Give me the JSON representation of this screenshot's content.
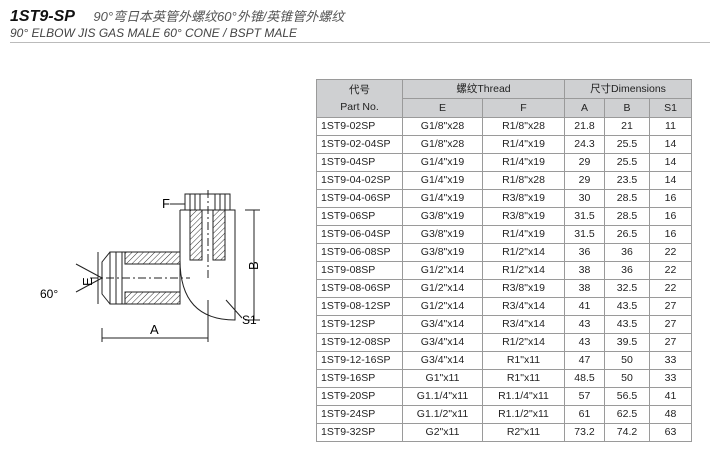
{
  "header": {
    "code": "1ST9-SP",
    "title_cn": "90°弯日本英管外螺纹60°外锥/英锥管外螺纹",
    "title_en": "90° ELBOW JIS GAS MALE 60° CONE / BSPT MALE"
  },
  "drawing": {
    "labels": {
      "f": "F",
      "b": "B",
      "e": "E",
      "a": "A",
      "s1": "S1",
      "angle": "60°"
    }
  },
  "table": {
    "header": {
      "code_cn": "代号",
      "part_no": "Part No.",
      "thread": "螺纹Thread",
      "dimensions": "尺寸Dimensions",
      "e": "E",
      "f": "F",
      "a": "A",
      "b": "B",
      "s1": "S1"
    },
    "rows": [
      [
        "1ST9-02SP",
        "G1/8\"x28",
        "R1/8\"x28",
        "21.8",
        "21",
        "11"
      ],
      [
        "1ST9-02-04SP",
        "G1/8\"x28",
        "R1/4\"x19",
        "24.3",
        "25.5",
        "14"
      ],
      [
        "1ST9-04SP",
        "G1/4\"x19",
        "R1/4\"x19",
        "29",
        "25.5",
        "14"
      ],
      [
        "1ST9-04-02SP",
        "G1/4\"x19",
        "R1/8\"x28",
        "29",
        "23.5",
        "14"
      ],
      [
        "1ST9-04-06SP",
        "G1/4\"x19",
        "R3/8\"x19",
        "30",
        "28.5",
        "16"
      ],
      [
        "1ST9-06SP",
        "G3/8\"x19",
        "R3/8\"x19",
        "31.5",
        "28.5",
        "16"
      ],
      [
        "1ST9-06-04SP",
        "G3/8\"x19",
        "R1/4\"x19",
        "31.5",
        "26.5",
        "16"
      ],
      [
        "1ST9-06-08SP",
        "G3/8\"x19",
        "R1/2\"x14",
        "36",
        "36",
        "22"
      ],
      [
        "1ST9-08SP",
        "G1/2\"x14",
        "R1/2\"x14",
        "38",
        "36",
        "22"
      ],
      [
        "1ST9-08-06SP",
        "G1/2\"x14",
        "R3/8\"x19",
        "38",
        "32.5",
        "22"
      ],
      [
        "1ST9-08-12SP",
        "G1/2\"x14",
        "R3/4\"x14",
        "41",
        "43.5",
        "27"
      ],
      [
        "1ST9-12SP",
        "G3/4\"x14",
        "R3/4\"x14",
        "43",
        "43.5",
        "27"
      ],
      [
        "1ST9-12-08SP",
        "G3/4\"x14",
        "R1/2\"x14",
        "43",
        "39.5",
        "27"
      ],
      [
        "1ST9-12-16SP",
        "G3/4\"x14",
        "R1\"x11",
        "47",
        "50",
        "33"
      ],
      [
        "1ST9-16SP",
        "G1\"x11",
        "R1\"x11",
        "48.5",
        "50",
        "33"
      ],
      [
        "1ST9-20SP",
        "G1.1/4\"x11",
        "R1.1/4\"x11",
        "57",
        "56.5",
        "41"
      ],
      [
        "1ST9-24SP",
        "G1.1/2\"x11",
        "R1.1/2\"x11",
        "61",
        "62.5",
        "48"
      ],
      [
        "1ST9-32SP",
        "G2\"x11",
        "R2\"x11",
        "73.2",
        "74.2",
        "63"
      ]
    ]
  }
}
